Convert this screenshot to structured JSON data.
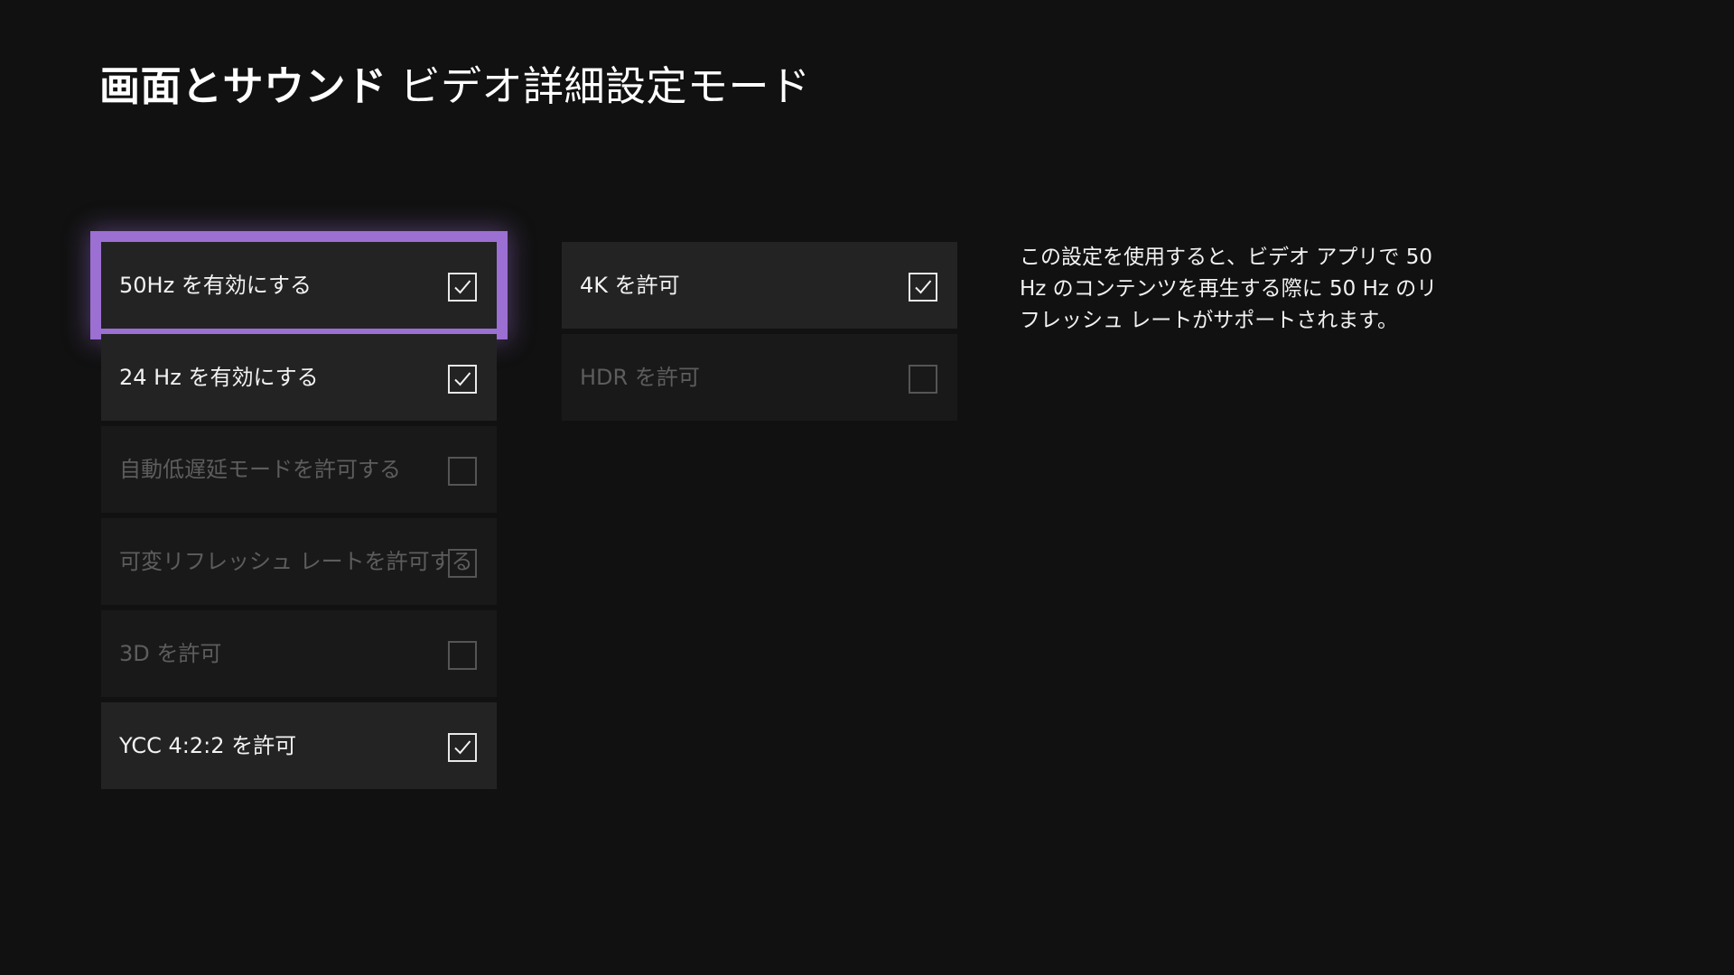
{
  "header": {
    "section": "画面とサウンド",
    "subtitle": "ビデオ詳細設定モード"
  },
  "left_column": [
    {
      "label": "50Hz を有効にする",
      "checked": true,
      "enabled": true,
      "focused": true
    },
    {
      "label": "24 Hz を有効にする",
      "checked": true,
      "enabled": true,
      "focused": false
    },
    {
      "label": "自動低遅延モードを許可する",
      "checked": false,
      "enabled": false,
      "focused": false
    },
    {
      "label": "可変リフレッシュ レートを許可する",
      "checked": false,
      "enabled": false,
      "focused": false
    },
    {
      "label": "3D を許可",
      "checked": false,
      "enabled": false,
      "focused": false
    },
    {
      "label": "YCC 4:2:2 を許可",
      "checked": true,
      "enabled": true,
      "focused": false
    }
  ],
  "right_column": [
    {
      "label": "4K を許可",
      "checked": true,
      "enabled": true,
      "focused": false
    },
    {
      "label": "HDR を許可",
      "checked": false,
      "enabled": false,
      "focused": false
    }
  ],
  "description": "この設定を使用すると、ビデオ アプリで 50 Hz のコンテンツを再生する際に 50 Hz のリフレッシュ レートがサポートされます。",
  "colors": {
    "background": "#111111",
    "tile": "#232323",
    "tile_disabled": "#191919",
    "focus": "#9c6fd2",
    "disabled_text": "#5d5d5d"
  }
}
